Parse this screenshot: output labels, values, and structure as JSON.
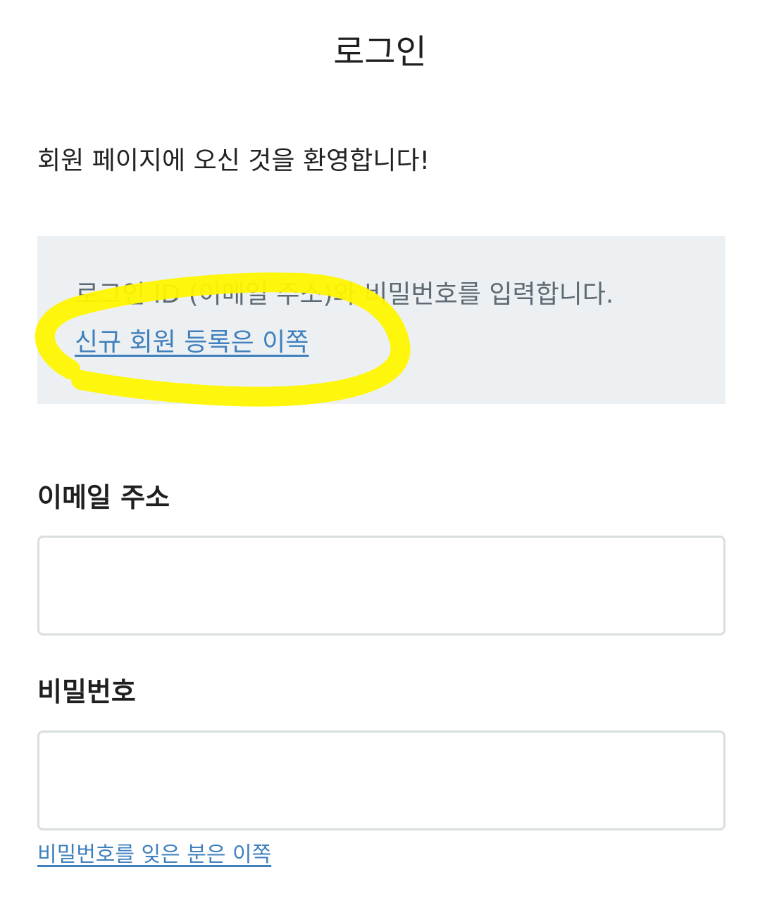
{
  "page": {
    "title": "로그인",
    "welcome": "회원 페이지에 오신 것을 환영합니다!"
  },
  "info": {
    "text": "로그인 ID (이메일 주소)와 비밀번호를 입력합니다.",
    "register_link": "신규 회원 등록은 이쪽",
    "highlight_color": "#fff500",
    "background_color": "#ecf0f3",
    "link_color": "#3f80bd"
  },
  "form": {
    "email_label": "이메일 주소",
    "email_value": "",
    "password_label": "비밀번호",
    "password_value": "",
    "forgot_link": "비밀번호를 잊은 분은 이쪽"
  }
}
